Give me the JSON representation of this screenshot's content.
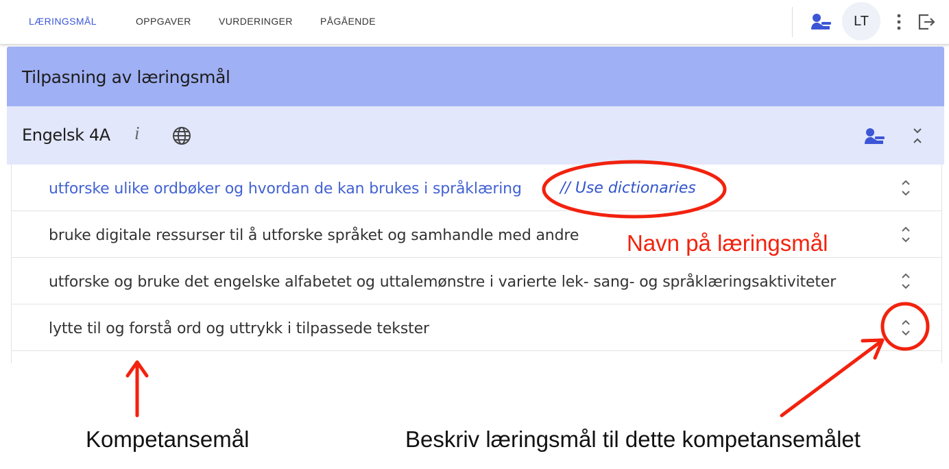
{
  "nav": {
    "tabs": [
      {
        "label": "LÆRINGSMÅL",
        "active": true
      },
      {
        "label": "OPPGAVER",
        "active": false
      },
      {
        "label": "VURDERINGER",
        "active": false
      },
      {
        "label": "PÅGÅENDE",
        "active": false
      }
    ],
    "avatar_initials": "LT",
    "icons": [
      "teacher-icon",
      "more-vert-icon",
      "logout-icon"
    ]
  },
  "panel": {
    "title": "Tilpasning av læringsmål",
    "subject": {
      "name": "Engelsk 4A",
      "info_icon": "i",
      "icons": [
        "globe-icon",
        "teacher-icon",
        "collapse-icon"
      ]
    },
    "competence_goals": [
      {
        "text": "utforske ulike ordbøker og hvordan de kan brukes i språklæring",
        "note": "// Use dictionaries",
        "highlighted": true
      },
      {
        "text": "bruke digitale ressurser til å utforske språket og samhandle med andre",
        "highlighted": false
      },
      {
        "text": "utforske og bruke det engelske alfabetet og uttalemønstre i varierte lek- sang- og språklæringsaktiviteter",
        "highlighted": false
      },
      {
        "text": "lytte til og forstå ord og uttrykk i tilpassede tekster",
        "highlighted": false
      }
    ]
  },
  "annotations": {
    "learning_goal_name": "Navn på læringsmål",
    "competence_goal": "Kompetansemål",
    "describe_goal": "Beskriv læringsmål til dette kompetansemålet"
  },
  "colors": {
    "accent": "#3c56d6",
    "header_bg": "#a0b0f4",
    "subheader_bg": "#e2e7fb",
    "annotation_red": "#f2220e"
  }
}
